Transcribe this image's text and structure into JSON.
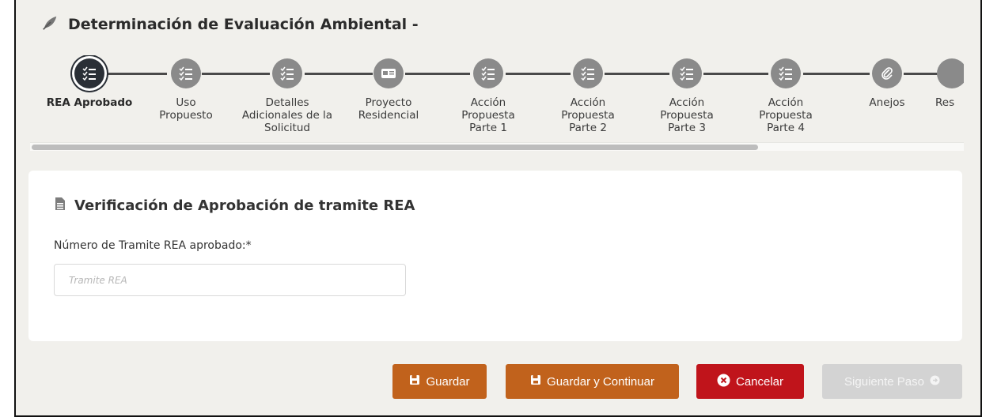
{
  "page": {
    "title": "Determinación de Evaluación Ambiental -"
  },
  "steps": [
    {
      "label": "REA Aprobado",
      "icon": "checklist-icon",
      "active": true
    },
    {
      "label": "Uso Propuesto",
      "icon": "checklist-icon",
      "active": false
    },
    {
      "label": "Detalles Adicionales de la Solicitud",
      "icon": "checklist-icon",
      "active": false
    },
    {
      "label": "Proyecto Residencial",
      "icon": "id-card-icon",
      "active": false
    },
    {
      "label": "Acción Propuesta Parte 1",
      "icon": "checklist-icon",
      "active": false
    },
    {
      "label": "Acción Propuesta Parte 2",
      "icon": "checklist-icon",
      "active": false
    },
    {
      "label": "Acción Propuesta Parte 3",
      "icon": "checklist-icon",
      "active": false
    },
    {
      "label": "Acción Propuesta Parte 4",
      "icon": "checklist-icon",
      "active": false
    },
    {
      "label": "Anejos",
      "icon": "paperclip-icon",
      "active": false
    },
    {
      "label": "Res",
      "icon": "checklist-icon",
      "active": false
    }
  ],
  "section": {
    "title": "Verificación de Aprobación de tramite REA",
    "field_label": "Número de Tramite REA aprobado:*",
    "field_placeholder": "Tramite REA",
    "field_value": ""
  },
  "buttons": {
    "guardar": "Guardar",
    "guardar_continuar": "Guardar y Continuar",
    "cancelar": "Cancelar",
    "siguiente": "Siguiente Paso"
  },
  "colors": {
    "accent_orange": "#c1621c",
    "cancel_red": "#c0141b",
    "disabled": "#d3d3d3",
    "step_active": "#2a2f36",
    "step_inactive": "#8a8a8a"
  }
}
